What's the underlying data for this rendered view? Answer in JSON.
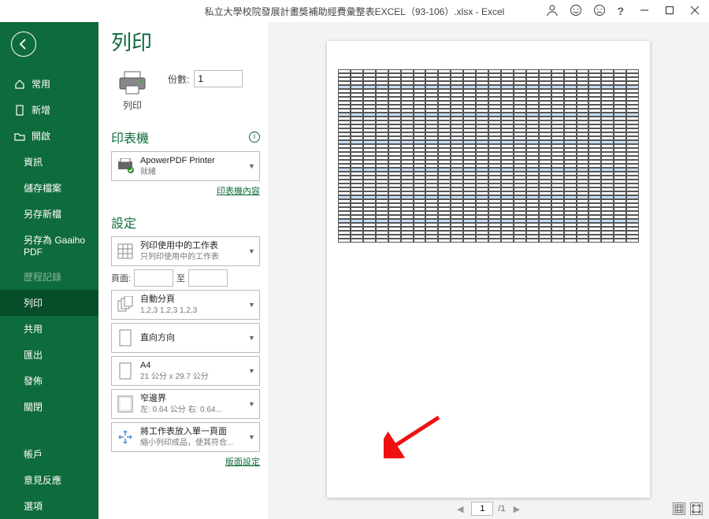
{
  "titlebar": {
    "title": "私立大學校院發展計畫獎補助經費彙整表EXCEL（93-106）.xlsx - Excel"
  },
  "sidebar": {
    "items": [
      {
        "label": "常用",
        "icon": "home"
      },
      {
        "label": "新增",
        "icon": "doc"
      },
      {
        "label": "開啟",
        "icon": "open"
      },
      {
        "label": "資訊",
        "indent": true
      },
      {
        "label": "儲存檔案",
        "indent": true
      },
      {
        "label": "另存新檔",
        "indent": true
      },
      {
        "label": "另存為 Gaaiho PDF",
        "indent": true
      },
      {
        "label": "歷程記錄",
        "indent": true,
        "disabled": true
      },
      {
        "label": "列印",
        "indent": true,
        "selected": true
      },
      {
        "label": "共用",
        "indent": true
      },
      {
        "label": "匯出",
        "indent": true
      },
      {
        "label": "發佈",
        "indent": true
      },
      {
        "label": "關閉",
        "indent": true
      }
    ],
    "bottom": [
      {
        "label": "帳戶"
      },
      {
        "label": "意見反應"
      },
      {
        "label": "選項"
      }
    ]
  },
  "print": {
    "heading": "列印",
    "print_button": "列印",
    "copies_label": "份數:",
    "copies_value": "1",
    "printer_section": "印表機",
    "printer_name": "ApowerPDF Printer",
    "printer_status": "就緒",
    "printer_props_link": "印表機內容",
    "settings_section": "設定",
    "combo_active_sheets_l1": "列印使用中的工作表",
    "combo_active_sheets_l2": "只列印使用中的工作表",
    "pages_label": "頁面:",
    "pages_to": "至",
    "combo_collate_l1": "自動分頁",
    "combo_collate_l2": "1,2,3   1,2,3   1,2,3",
    "combo_orient_l1": "直向方向",
    "combo_paper_l1": "A4",
    "combo_paper_l2": "21 公分 x 29.7 公分",
    "combo_margin_l1": "窄邊界",
    "combo_margin_l2": "左: 0.64 公分   右: 0.64...",
    "combo_scale_l1": "將工作表放入單一頁面",
    "combo_scale_l2": "縮小列印成品，使其符合...",
    "page_setup_link": "版面設定"
  },
  "preview": {
    "current_page": "1",
    "total_pages": "/1"
  }
}
